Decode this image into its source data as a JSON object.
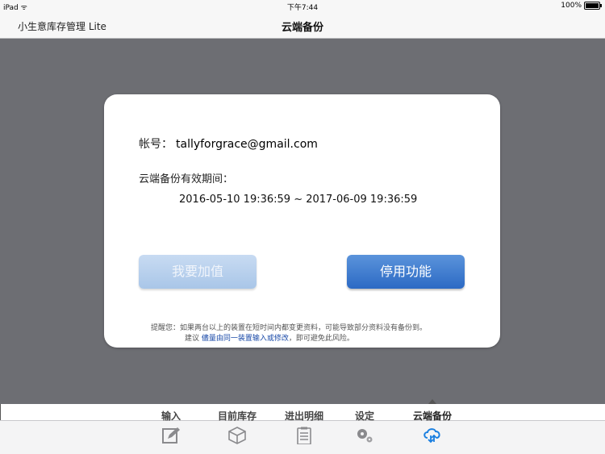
{
  "status_bar": {
    "device": "iPad",
    "time": "下午7:44",
    "battery": "100%"
  },
  "nav": {
    "app_title": "小生意库存管理 Lite",
    "page_title": "云端备份"
  },
  "modal": {
    "account_label": "帐号：",
    "account_value": "tallyforgrace@gmail.com",
    "period_label": "云端备份有效期间：",
    "period_value": "2016-05-10 19:36:59 ~ 2017-06-09 19:36:59",
    "topup_button": "我要加值",
    "disable_button": "停用功能",
    "notice_line1": "提醒您：如果两台以上的装置在短时间内都变更资料，可能导致部分资料没有备份到。",
    "notice_line2_prefix": "建议 ",
    "notice_line2_link": "儘量由同一装置输入或修改",
    "notice_line2_suffix": "，即可避免此风险。"
  },
  "tabs": [
    {
      "label": "输入",
      "icon": "edit-icon"
    },
    {
      "label": "目前库存",
      "icon": "box-icon"
    },
    {
      "label": "进出明细",
      "icon": "clipboard-icon"
    },
    {
      "label": "设定",
      "icon": "gear-icon"
    },
    {
      "label": "云端备份",
      "icon": "cloud-sync-icon",
      "active": true
    }
  ],
  "colors": {
    "accent": "#1a7fe0",
    "overlay": "#6d6e73",
    "primary_button": "#3a78cc"
  }
}
